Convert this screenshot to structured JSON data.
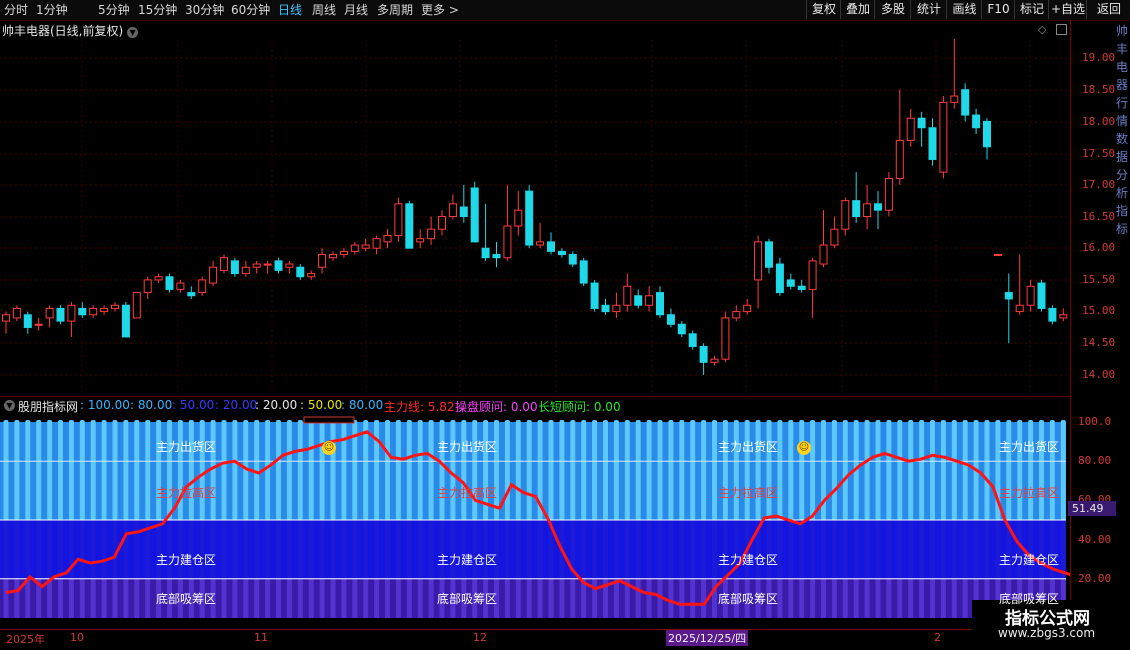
{
  "toolbar": {
    "periods": [
      "分时",
      "1分钟",
      "5分钟",
      "15分钟",
      "30分钟",
      "60分钟",
      "日线",
      "周线",
      "月线",
      "多周期",
      "更多 >"
    ],
    "active_period": "日线",
    "right_buttons": [
      "复权",
      "叠加",
      "多股",
      "统计",
      "画线",
      "F10",
      "标记",
      "+自选",
      "返回"
    ]
  },
  "stock": {
    "title": "帅丰电器(日线,前复权)"
  },
  "indicator": {
    "name": "股朋指标网",
    "levels": [
      {
        "text": ": 100.00",
        "color": "#3ab4ff"
      },
      {
        "text": ": 80.00",
        "color": "#3ab4ff"
      },
      {
        "text": ": 50.00",
        "color": "#3a3aff"
      },
      {
        "text": ": 20.00",
        "color": "#3a3aff"
      },
      {
        "text": ": 20.00",
        "color": "#e6e6e6"
      },
      {
        "text": ": 50.00",
        "color": "#e6e600"
      },
      {
        "text": ": 80.00",
        "color": "#3ab4ff"
      }
    ],
    "main_line": {
      "label": "主力线: 5.82",
      "color": "#ff2a2a"
    },
    "operator": {
      "label": "操盘顾问: 0.00",
      "color": "#ff3cff"
    },
    "short_long": {
      "label": "长短顾问: 0.00",
      "color": "#2ae62a"
    },
    "current_value": "51.49",
    "zones": {
      "top": "主力出货区",
      "upper": "主力拉高区",
      "lower": "主力建仓区",
      "bottom": "底部吸筹区"
    }
  },
  "price_axis": [
    "19.00",
    "18.50",
    "18.00",
    "17.50",
    "17.00",
    "16.50",
    "16.00",
    "15.50",
    "15.00",
    "14.50",
    "14.00"
  ],
  "indicator_axis": [
    "100.0",
    "80.00",
    "60.00",
    "40.00",
    "20.00"
  ],
  "dates": {
    "year": "2025年",
    "m10": "10",
    "m11": "11",
    "m12": "12",
    "cursor": "2025/12/25/四",
    "m2": "2"
  },
  "side_glyphs": "帅丰电器行情数据分析指标",
  "watermark": {
    "line1": "指标公式网",
    "line2": "www.zbgs3.com"
  },
  "colors": {
    "up": "#ff3c3c",
    "down": "#1fd8e8",
    "main_line": "#ff1414"
  },
  "chart_data": {
    "type": "candlestick",
    "ylim": [
      13.9,
      19.3
    ],
    "candles": [
      [
        14.85,
        14.95,
        14.65,
        15.0
      ],
      [
        14.9,
        15.05,
        14.85,
        15.1
      ],
      [
        14.95,
        14.75,
        14.65,
        15.0
      ],
      [
        14.8,
        14.8,
        14.7,
        14.9
      ],
      [
        14.9,
        15.05,
        14.75,
        15.1
      ],
      [
        15.05,
        14.85,
        14.8,
        15.1
      ],
      [
        14.85,
        15.1,
        14.6,
        15.15
      ],
      [
        15.05,
        14.95,
        14.9,
        15.15
      ],
      [
        14.95,
        15.05,
        14.9,
        15.1
      ],
      [
        15.0,
        15.05,
        14.95,
        15.1
      ],
      [
        15.05,
        15.1,
        15.0,
        15.15
      ],
      [
        15.1,
        14.6,
        14.6,
        15.15
      ],
      [
        14.9,
        15.3,
        14.9,
        15.3
      ],
      [
        15.3,
        15.5,
        15.2,
        15.55
      ],
      [
        15.5,
        15.55,
        15.45,
        15.6
      ],
      [
        15.55,
        15.35,
        15.3,
        15.6
      ],
      [
        15.35,
        15.45,
        15.3,
        15.5
      ],
      [
        15.3,
        15.25,
        15.2,
        15.4
      ],
      [
        15.3,
        15.5,
        15.25,
        15.55
      ],
      [
        15.45,
        15.7,
        15.4,
        15.8
      ],
      [
        15.65,
        15.85,
        15.6,
        15.9
      ],
      [
        15.8,
        15.6,
        15.55,
        15.85
      ],
      [
        15.6,
        15.7,
        15.55,
        15.8
      ],
      [
        15.7,
        15.75,
        15.6,
        15.8
      ],
      [
        15.75,
        15.75,
        15.6,
        15.8
      ],
      [
        15.8,
        15.65,
        15.6,
        15.85
      ],
      [
        15.7,
        15.75,
        15.6,
        15.8
      ],
      [
        15.7,
        15.55,
        15.5,
        15.75
      ],
      [
        15.55,
        15.6,
        15.5,
        15.65
      ],
      [
        15.7,
        15.9,
        15.6,
        16.0
      ],
      [
        15.85,
        15.9,
        15.8,
        15.95
      ],
      [
        15.9,
        15.95,
        15.85,
        16.0
      ],
      [
        15.95,
        16.05,
        15.9,
        16.1
      ],
      [
        16.0,
        16.05,
        15.95,
        16.15
      ],
      [
        16.0,
        16.15,
        15.9,
        16.2
      ],
      [
        16.1,
        16.2,
        16.0,
        16.3
      ],
      [
        16.2,
        16.7,
        16.1,
        16.8
      ],
      [
        16.7,
        16.0,
        16.0,
        16.75
      ],
      [
        16.1,
        16.15,
        16.0,
        16.3
      ],
      [
        16.15,
        16.3,
        16.05,
        16.5
      ],
      [
        16.3,
        16.5,
        16.2,
        16.6
      ],
      [
        16.5,
        16.7,
        16.45,
        16.85
      ],
      [
        16.65,
        16.5,
        16.4,
        17.0
      ],
      [
        16.95,
        16.1,
        16.1,
        17.05
      ],
      [
        16.0,
        15.85,
        15.8,
        16.7
      ],
      [
        15.9,
        15.85,
        15.7,
        16.1
      ],
      [
        15.85,
        16.35,
        15.8,
        17.0
      ],
      [
        16.35,
        16.6,
        16.2,
        16.9
      ],
      [
        16.9,
        16.05,
        16.0,
        17.0
      ],
      [
        16.05,
        16.1,
        16.0,
        16.4
      ],
      [
        16.1,
        15.95,
        15.9,
        16.25
      ],
      [
        15.95,
        15.9,
        15.85,
        16.0
      ],
      [
        15.9,
        15.75,
        15.7,
        15.95
      ],
      [
        15.8,
        15.45,
        15.4,
        15.85
      ],
      [
        15.45,
        15.05,
        15.0,
        15.5
      ],
      [
        15.1,
        15.0,
        14.95,
        15.2
      ],
      [
        15.0,
        15.1,
        14.9,
        15.3
      ],
      [
        15.1,
        15.4,
        15.0,
        15.6
      ],
      [
        15.25,
        15.1,
        15.05,
        15.35
      ],
      [
        15.1,
        15.25,
        15.0,
        15.4
      ],
      [
        15.3,
        14.95,
        14.9,
        15.4
      ],
      [
        14.95,
        14.8,
        14.75,
        15.05
      ],
      [
        14.8,
        14.65,
        14.6,
        14.85
      ],
      [
        14.65,
        14.45,
        14.4,
        14.7
      ],
      [
        14.45,
        14.2,
        14.0,
        14.5
      ],
      [
        14.2,
        14.25,
        14.15,
        14.3
      ],
      [
        14.25,
        14.9,
        14.2,
        15.0
      ],
      [
        14.9,
        15.0,
        14.85,
        15.1
      ],
      [
        15.0,
        15.1,
        14.95,
        15.2
      ],
      [
        15.5,
        16.1,
        15.05,
        16.2
      ],
      [
        16.1,
        15.7,
        15.6,
        16.15
      ],
      [
        15.75,
        15.3,
        15.25,
        15.85
      ],
      [
        15.5,
        15.4,
        15.35,
        15.6
      ],
      [
        15.4,
        15.35,
        15.3,
        15.5
      ],
      [
        15.35,
        15.8,
        14.9,
        15.85
      ],
      [
        15.75,
        16.05,
        15.7,
        16.6
      ],
      [
        16.05,
        16.3,
        16.0,
        16.5
      ],
      [
        16.3,
        16.75,
        16.2,
        16.8
      ],
      [
        16.75,
        16.5,
        16.4,
        17.2
      ],
      [
        16.5,
        16.7,
        16.3,
        17.0
      ],
      [
        16.7,
        16.6,
        16.3,
        16.9
      ],
      [
        16.6,
        17.1,
        16.5,
        17.2
      ],
      [
        17.1,
        17.7,
        17.0,
        18.5
      ],
      [
        17.7,
        18.05,
        17.6,
        18.2
      ],
      [
        18.05,
        17.9,
        17.6,
        18.15
      ],
      [
        17.9,
        17.4,
        17.3,
        18.05
      ],
      [
        17.2,
        18.3,
        17.1,
        18.4
      ],
      [
        18.3,
        18.4,
        18.2,
        19.3
      ],
      [
        18.5,
        18.1,
        18.0,
        18.6
      ],
      [
        18.1,
        17.9,
        17.8,
        18.2
      ],
      [
        18.0,
        17.6,
        17.4,
        18.05
      ],
      [
        15.9,
        15.9,
        15.9,
        15.9
      ],
      [
        15.3,
        15.2,
        14.5,
        15.6
      ],
      [
        15.0,
        15.1,
        14.95,
        15.9
      ],
      [
        15.1,
        15.4,
        15.0,
        15.5
      ],
      [
        15.45,
        15.05,
        15.0,
        15.5
      ],
      [
        15.05,
        14.85,
        14.8,
        15.1
      ],
      [
        14.9,
        14.95,
        14.85,
        15.05
      ],
      [
        14.95,
        15.05,
        14.9,
        15.1
      ],
      [
        15.05,
        15.15,
        15.0,
        15.2
      ],
      [
        15.2,
        15.1,
        15.05,
        15.3
      ],
      [
        15.35,
        15.25,
        15.2,
        15.4
      ],
      [
        15.25,
        15.05,
        15.0,
        15.3
      ],
      [
        15.25,
        15.05,
        15.0,
        15.3
      ],
      [
        15.05,
        14.95,
        14.9,
        15.1
      ],
      [
        14.95,
        14.25,
        14.2,
        15.0
      ],
      [
        14.3,
        14.2,
        14.1,
        14.35
      ]
    ],
    "main_line": [
      13,
      14,
      21,
      16,
      21,
      23,
      30,
      28,
      29,
      31,
      43,
      44,
      46,
      48,
      56,
      67,
      72,
      76,
      79,
      80,
      76,
      74,
      78,
      83,
      85,
      86,
      88,
      90,
      91,
      93,
      95,
      90,
      82,
      81,
      83,
      84,
      80,
      74,
      69,
      60,
      58,
      56,
      68,
      64,
      62,
      51,
      37,
      25,
      18,
      15,
      17,
      19,
      16,
      13,
      12,
      9,
      7,
      7,
      7,
      16,
      22,
      28,
      40,
      51,
      52,
      50,
      48,
      52,
      60,
      66,
      73,
      78,
      82,
      84,
      82,
      80,
      81,
      83,
      82,
      80,
      78,
      74,
      67,
      50,
      39,
      32,
      28,
      25,
      23,
      21,
      20,
      20,
      20,
      19,
      17,
      15,
      5
    ]
  }
}
